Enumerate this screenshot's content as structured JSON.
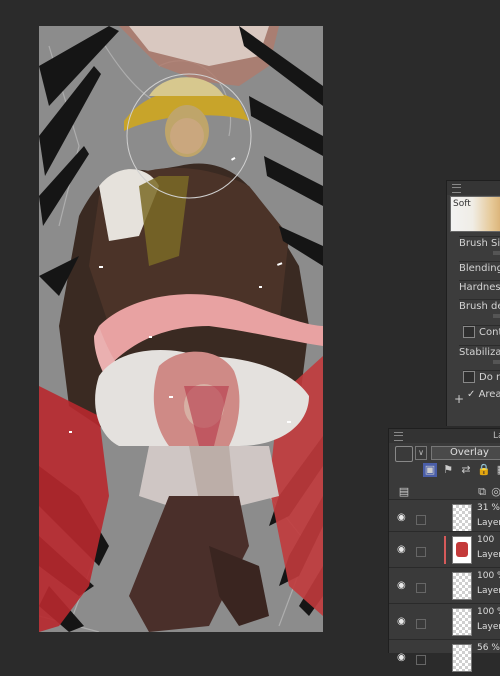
{
  "brush_panel": {
    "preview_label": "Soft",
    "properties": [
      {
        "label": "Brush Siz"
      },
      {
        "label": "Blending"
      },
      {
        "label": "Hardness"
      },
      {
        "label": "Brush de"
      },
      {
        "label": "Conti"
      },
      {
        "label": "Stabilizat"
      },
      {
        "label": "Do not"
      },
      {
        "label": "Area"
      }
    ],
    "add_symbol": "+"
  },
  "layers_panel": {
    "title": "La",
    "blend_mode": "Overlay",
    "layers": [
      {
        "opacity": "31 %",
        "name": "Layer"
      },
      {
        "opacity": "100",
        "name": "Layer"
      },
      {
        "opacity": "100 %",
        "name": "Layer"
      },
      {
        "opacity": "100 %",
        "name": "Layer"
      },
      {
        "opacity": "56 %",
        "name": ""
      }
    ]
  },
  "colors": {
    "background": "#2b2b2b",
    "panel": "#3c3c3c",
    "accent_red": "#c43a3a",
    "hair_pink": "#e59a9a",
    "hat_yellow": "#c8a42a"
  }
}
